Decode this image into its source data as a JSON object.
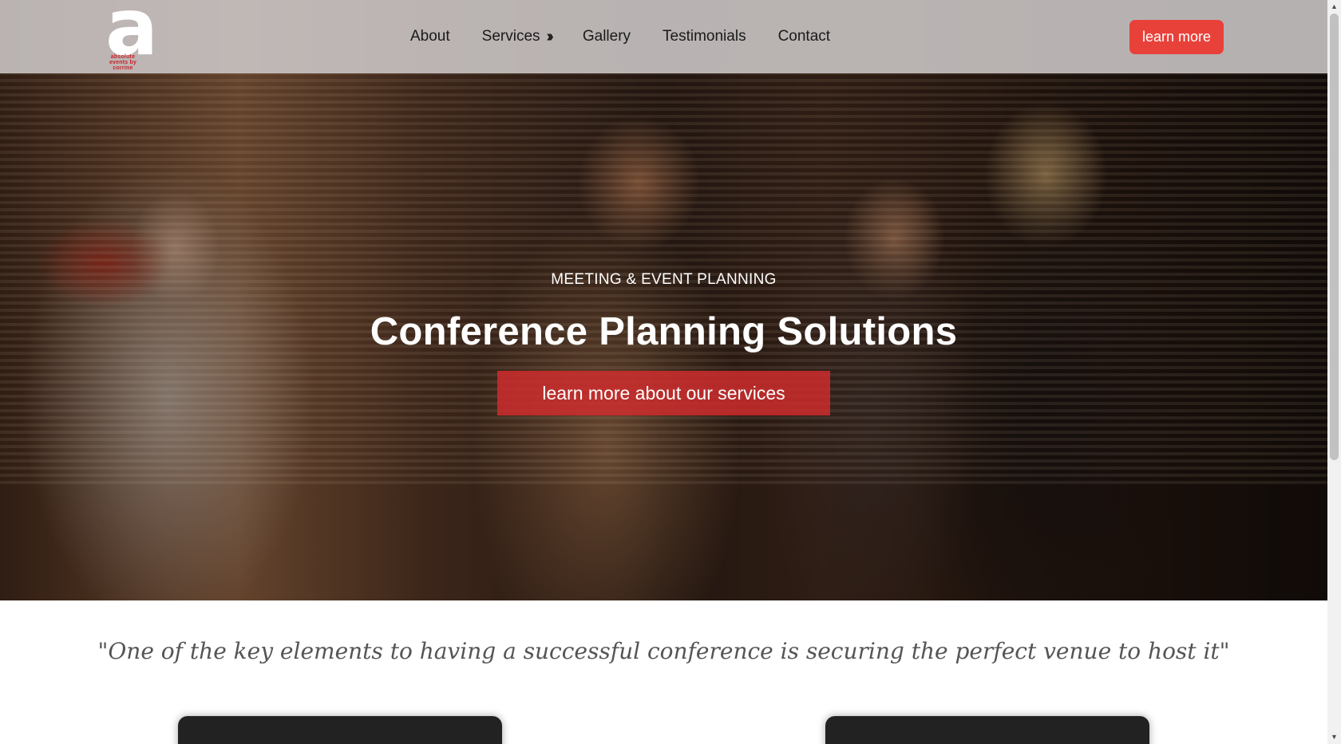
{
  "header": {
    "logo_text": "absolute events by corrine",
    "nav": [
      {
        "label": "About"
      },
      {
        "label": "Services",
        "icon": "double-chevron-right-icon"
      },
      {
        "label": "Gallery"
      },
      {
        "label": "Testimonials"
      },
      {
        "label": "Contact"
      }
    ],
    "cta_label": "learn more"
  },
  "hero": {
    "eyebrow": "MEETING & EVENT PLANNING",
    "title": "Conference Planning Solutions",
    "button_label": "learn more about our services"
  },
  "quote": "\"One of the key elements to having a successful conference is securing the perfect venue to host it\"",
  "colors": {
    "accent": "#e8413a",
    "hero_button": "#cd2d2d",
    "card": "#222222"
  }
}
